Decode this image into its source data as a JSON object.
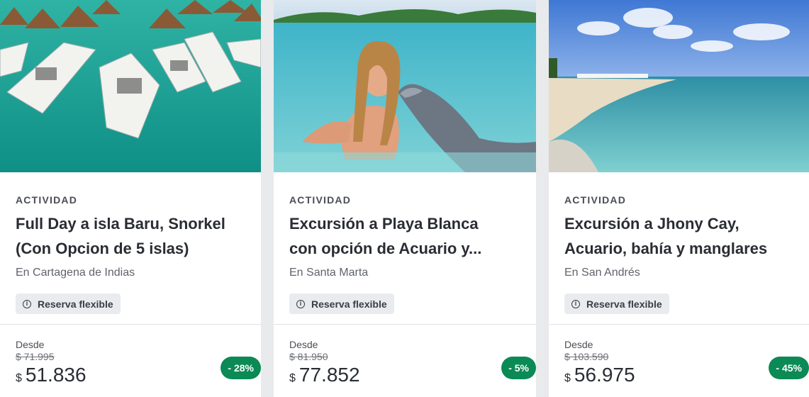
{
  "colors": {
    "discount_badge": "#0b8a55",
    "badge_bg": "#e9ebee",
    "title_text": "#2a2d33"
  },
  "cards": [
    {
      "image_label": "boats-lagoon-photo",
      "type_label": "ACTIVIDAD",
      "title": "Full Day a isla Baru, Snorkel\n(Con Opcion de 5 islas)",
      "location": "En Cartagena de Indias",
      "badge_icon": "info-icon",
      "badge_label": "Reserva flexible",
      "from_label": "Desde",
      "old_price": "$ 71.995",
      "currency": "$",
      "price": "51.836",
      "discount": "- 28%"
    },
    {
      "image_label": "dolphin-swim-photo",
      "type_label": "ACTIVIDAD",
      "title": "Excursión a Playa Blanca\ncon opción de Acuario y...",
      "location": "En Santa Marta",
      "badge_icon": "info-icon",
      "badge_label": "Reserva flexible",
      "from_label": "Desde",
      "old_price": "$ 81.950",
      "currency": "$",
      "price": "77.852",
      "discount": "- 5%"
    },
    {
      "image_label": "beach-cay-photo",
      "type_label": "ACTIVIDAD",
      "title": "Excursión a Jhony Cay,\nAcuario, bahía y manglares",
      "location": "En San Andrés",
      "badge_icon": "info-icon",
      "badge_label": "Reserva flexible",
      "from_label": "Desde",
      "old_price": "$ 103.590",
      "currency": "$",
      "price": "56.975",
      "discount": "- 45%"
    }
  ]
}
